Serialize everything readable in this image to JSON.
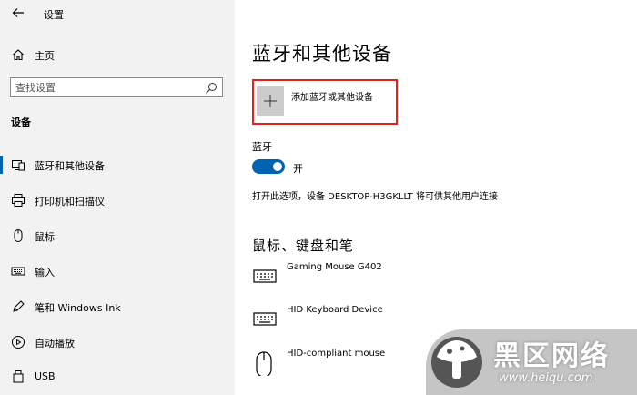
{
  "window": {
    "title": "设置"
  },
  "sidebar": {
    "home_label": "主页",
    "search_placeholder": "查找设置",
    "section_title": "设备",
    "items": [
      {
        "label": "蓝牙和其他设备",
        "icon": "bluetooth-devices-icon",
        "active": true
      },
      {
        "label": "打印机和扫描仪",
        "icon": "printer-icon",
        "active": false
      },
      {
        "label": "鼠标",
        "icon": "mouse-icon",
        "active": false
      },
      {
        "label": "输入",
        "icon": "keyboard-icon",
        "active": false
      },
      {
        "label": "笔和 Windows Ink",
        "icon": "pen-icon",
        "active": false
      },
      {
        "label": "自动播放",
        "icon": "autoplay-icon",
        "active": false
      },
      {
        "label": "USB",
        "icon": "usb-icon",
        "active": false
      }
    ]
  },
  "main": {
    "title": "蓝牙和其他设备",
    "add_device_label": "添加蓝牙或其他设备",
    "bluetooth_label": "蓝牙",
    "bluetooth_state": "开",
    "bluetooth_on": true,
    "discover_text": "打开此选项，设备 DESKTOP-H3GKLLT 将可供其他用户连接",
    "peripherals_title": "鼠标、键盘和笔",
    "devices": [
      {
        "name": "Gaming Mouse G402",
        "icon": "keyboard-icon"
      },
      {
        "name": "HID Keyboard Device",
        "icon": "keyboard-icon"
      },
      {
        "name": "HID-compliant mouse",
        "icon": "mouse-icon"
      }
    ]
  },
  "watermark": {
    "text": "黑区网络",
    "url": "www.heiqu.com"
  },
  "colors": {
    "accent": "#0063b1",
    "highlight_border": "#e2231a",
    "sidebar_bg": "#f2f2f2"
  }
}
